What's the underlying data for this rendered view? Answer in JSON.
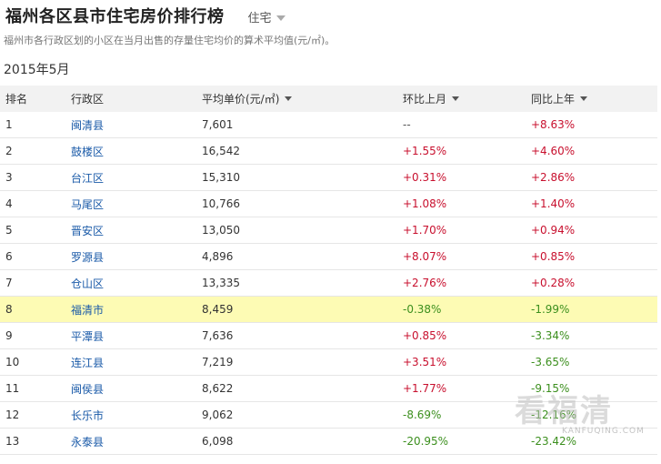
{
  "header": {
    "title": "福州各区县市住宅房价排行榜",
    "type_selected": "住宅"
  },
  "subtitle": "福州市各行政区划的小区在当月出售的存量住宅均价的算术平均值(元/㎡)。",
  "period": "2015年5月",
  "table": {
    "columns": [
      "排名",
      "行政区",
      "平均单价(元/㎡)",
      "环比上月",
      "同比上年"
    ],
    "rows": [
      {
        "rank": "1",
        "district": "闽清县",
        "price": "7,601",
        "mom": "--",
        "yoy": "+8.63%"
      },
      {
        "rank": "2",
        "district": "鼓楼区",
        "price": "16,542",
        "mom": "+1.55%",
        "yoy": "+4.60%"
      },
      {
        "rank": "3",
        "district": "台江区",
        "price": "15,310",
        "mom": "+0.31%",
        "yoy": "+2.86%"
      },
      {
        "rank": "4",
        "district": "马尾区",
        "price": "10,766",
        "mom": "+1.08%",
        "yoy": "+1.40%"
      },
      {
        "rank": "5",
        "district": "晋安区",
        "price": "13,050",
        "mom": "+1.70%",
        "yoy": "+0.94%"
      },
      {
        "rank": "6",
        "district": "罗源县",
        "price": "4,896",
        "mom": "+8.07%",
        "yoy": "+0.85%"
      },
      {
        "rank": "7",
        "district": "仓山区",
        "price": "13,335",
        "mom": "+2.76%",
        "yoy": "+0.28%"
      },
      {
        "rank": "8",
        "district": "福清市",
        "price": "8,459",
        "mom": "-0.38%",
        "yoy": "-1.99%",
        "highlight": true
      },
      {
        "rank": "9",
        "district": "平潭县",
        "price": "7,636",
        "mom": "+0.85%",
        "yoy": "-3.34%"
      },
      {
        "rank": "10",
        "district": "连江县",
        "price": "7,219",
        "mom": "+3.51%",
        "yoy": "-3.65%"
      },
      {
        "rank": "11",
        "district": "闽侯县",
        "price": "8,622",
        "mom": "+1.77%",
        "yoy": "-9.15%"
      },
      {
        "rank": "12",
        "district": "长乐市",
        "price": "9,062",
        "mom": "-8.69%",
        "yoy": "-12.16%"
      },
      {
        "rank": "13",
        "district": "永泰县",
        "price": "6,098",
        "mom": "-20.95%",
        "yoy": "-23.42%"
      }
    ]
  },
  "watermark": {
    "text": "看福清",
    "sub": "KANFUQING.COM"
  },
  "colors": {
    "link": "#1a5aa8",
    "up": "#c8102e",
    "down": "#3c8f1e",
    "highlight": "#fdfbb4",
    "header_bg": "#f2f2f2"
  },
  "icons": {
    "type_select": "caret-down-icon",
    "sort": "sort-desc-icon"
  }
}
